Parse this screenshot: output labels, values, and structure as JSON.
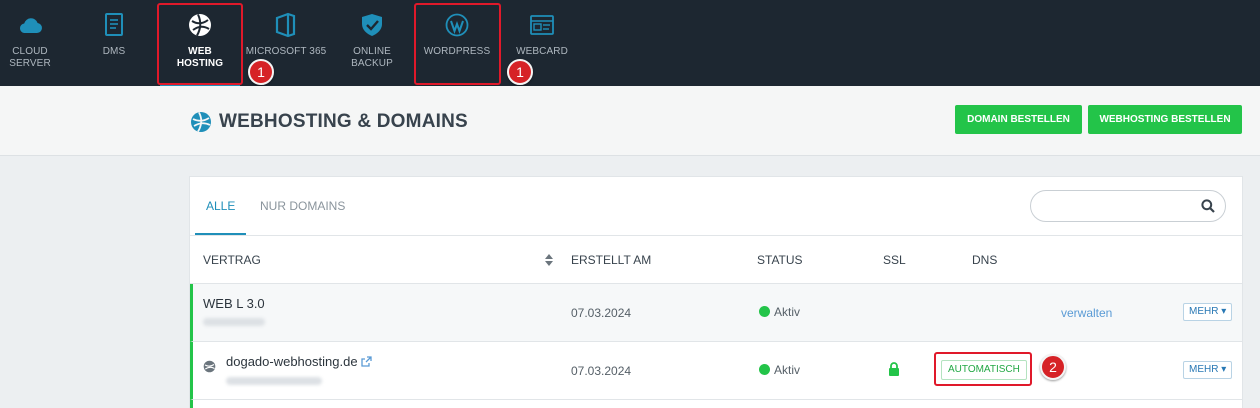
{
  "nav": {
    "items": [
      {
        "label": "CLOUD\nSERVER",
        "icon": "cloud-icon"
      },
      {
        "label": "DMS",
        "icon": "document-icon"
      },
      {
        "label": "WEB\nHOSTING",
        "icon": "globe-icon",
        "active": true
      },
      {
        "label": "MICROSOFT 365",
        "icon": "office-icon"
      },
      {
        "label": "ONLINE\nBACKUP",
        "icon": "shield-icon"
      },
      {
        "label": "WORDPRESS",
        "icon": "wordpress-icon"
      },
      {
        "label": "WEBCARD",
        "icon": "webcard-icon"
      }
    ],
    "badges": [
      "1",
      "1"
    ]
  },
  "header": {
    "title": "WEBHOSTING & DOMAINS",
    "btn_domain": "DOMAIN BESTELLEN",
    "btn_webhosting": "WEBHOSTING BESTELLEN"
  },
  "tabs": [
    "ALLE",
    "NUR DOMAINS"
  ],
  "search": {
    "placeholder": "",
    "value": ""
  },
  "table": {
    "columns": [
      "VERTRAG",
      "ERSTELLT AM",
      "STATUS",
      "SSL",
      "DNS"
    ],
    "rows": [
      {
        "name": "WEB L 3.0",
        "created": "07.03.2024",
        "status": "Aktiv",
        "action": "verwalten",
        "more": "MEHR"
      },
      {
        "name": "dogado-webhosting.de",
        "created": "07.03.2024",
        "status": "Aktiv",
        "dns": "AUTOMATISCH",
        "more": "MEHR",
        "badge": "2"
      }
    ]
  },
  "colors": {
    "accent": "#1f8fb9",
    "green": "#23c449",
    "nav_bg": "#1d2731",
    "callout": "#e0192a"
  }
}
